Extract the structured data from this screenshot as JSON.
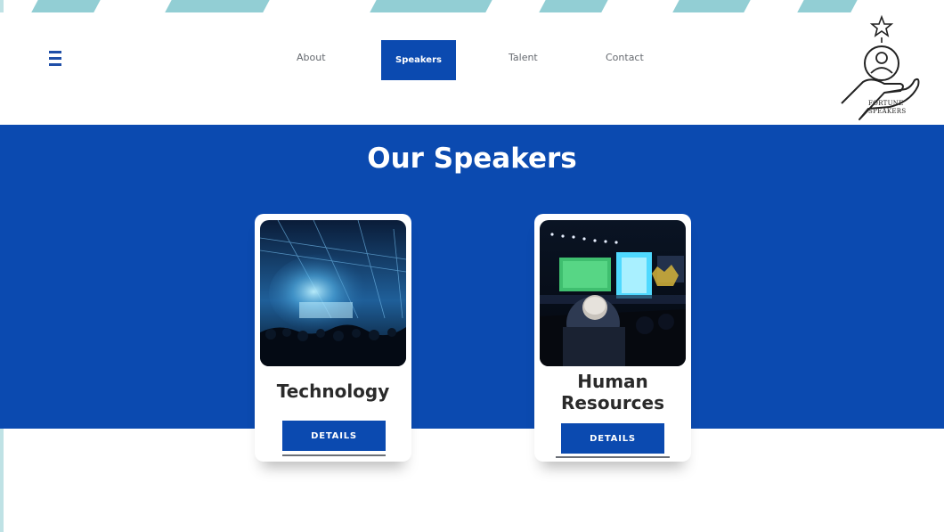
{
  "header": {
    "nav": {
      "about": "About",
      "speakers": "Speakers",
      "talent": "Talent",
      "contact": "Contact"
    },
    "logo": {
      "line1": "FORTUNE",
      "line2": "SPEAKERS"
    }
  },
  "main": {
    "title": "Our Speakers",
    "cards": [
      {
        "title": "Technology",
        "button": "DETAILS"
      },
      {
        "title_line1": "Human",
        "title_line2": "Resources",
        "button": "DETAILS"
      }
    ]
  },
  "colors": {
    "brand_blue": "#0b4ab0",
    "accent_teal": "#7fc6cc",
    "white": "#ffffff"
  }
}
